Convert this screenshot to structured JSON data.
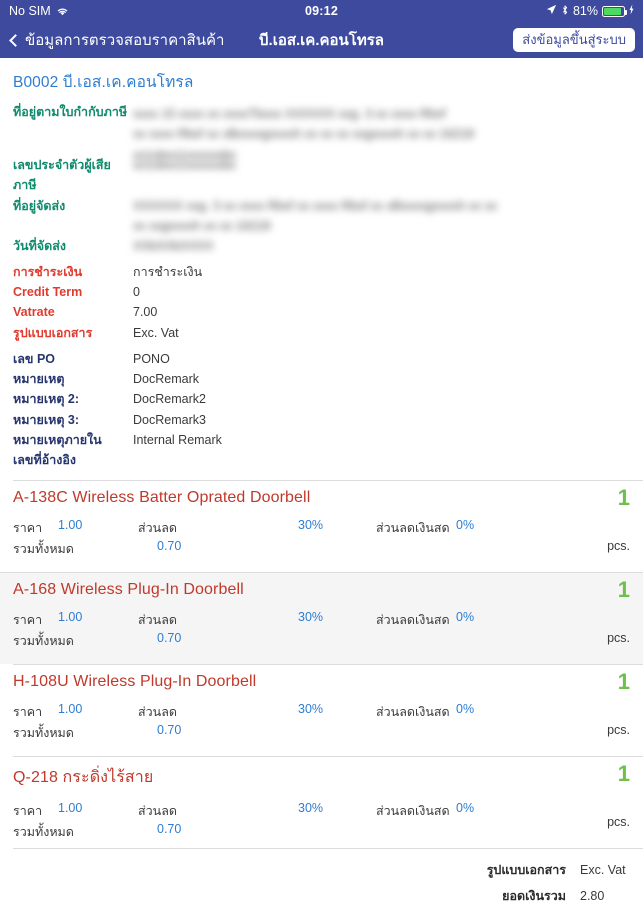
{
  "statusbar": {
    "carrier": "No SIM",
    "wifi_icon": "wifi-icon",
    "time": "09:12",
    "location_icon": "location-arrow-icon",
    "bluetooth_icon": "bluetooth-icon",
    "battery_percent": "81%",
    "battery_icon": "battery-icon",
    "charging_icon": "charging-bolt-icon"
  },
  "navbar": {
    "back_icon": "chevron-left-icon",
    "back_label": "ข้อมูลการตรวจสอบราคาสินค้า",
    "title": "บี.เอส.เค.คอนโทรล",
    "submit_label": "ส่งข้อมูลขึ้นสู่ระบบ"
  },
  "customer": {
    "heading": "B0002 บี.เอส.เค.คอนโทรล"
  },
  "info_rows": [
    {
      "label": "ที่อยู่ตามใบกำกับภาษี",
      "value": "",
      "label_color": "teal",
      "redacted": true
    },
    {
      "label": "เลขประจำตัวผู้เสียภาษี",
      "value": "",
      "label_color": "teal",
      "redacted": true
    },
    {
      "label": "ที่อยู่จัดส่ง",
      "value": "",
      "label_color": "teal",
      "redacted": true
    },
    {
      "label": "วันที่จัดส่ง",
      "value": "",
      "label_color": "teal",
      "redacted": true
    },
    {
      "label": "การชำระเงิน",
      "value": "การชำระเงิน",
      "label_color": "red",
      "redacted": false
    },
    {
      "label": "Credit Term",
      "value": "0",
      "label_color": "red",
      "redacted": false
    },
    {
      "label": "Vatrate",
      "value": "7.00",
      "label_color": "red",
      "redacted": false
    },
    {
      "label": "รูปแบบเอกสาร",
      "value": "Exc. Vat",
      "label_color": "red",
      "redacted": false
    },
    {
      "label": "เลข PO",
      "value": "PONO",
      "label_color": "navy",
      "redacted": false
    },
    {
      "label": "หมายเหตุ",
      "value": "DocRemark",
      "label_color": "navy",
      "redacted": false
    },
    {
      "label": "หมายเหตุ 2:",
      "value": "DocRemark2",
      "label_color": "navy",
      "redacted": false
    },
    {
      "label": "หมายเหตุ 3:",
      "value": "DocRemark3",
      "label_color": "navy",
      "redacted": false
    },
    {
      "label": "หมายเหตุภายใน",
      "value": "Internal Remark",
      "label_color": "navy",
      "redacted": false
    },
    {
      "label": "เลขที่อ้างอิง",
      "value": "",
      "label_color": "navy",
      "redacted": false
    }
  ],
  "item_field_labels": {
    "price": "ราคา",
    "discount": "ส่วนลด",
    "cash_discount": "ส่วนลดเงินสด",
    "total": "รวมทั้งหมด",
    "unit": "pcs."
  },
  "items": [
    {
      "name": "A-138C Wireless  Batter Oprated Doorbell",
      "price": "1.00",
      "discount": "30%",
      "cash_discount": "0%",
      "total": "0.70",
      "qty": "1",
      "unit": "pcs."
    },
    {
      "name": "A-168 Wireless Plug-In Doorbell",
      "price": "1.00",
      "discount": "30%",
      "cash_discount": "0%",
      "total": "0.70",
      "qty": "1",
      "unit": "pcs."
    },
    {
      "name": "H-108U Wireless Plug-In Doorbell",
      "price": "1.00",
      "discount": "30%",
      "cash_discount": "0%",
      "total": "0.70",
      "qty": "1",
      "unit": "pcs."
    },
    {
      "name": "Q-218 กระดิ่งไร้สาย",
      "price": "1.00",
      "discount": "30%",
      "cash_discount": "0%",
      "total": "0.70",
      "qty": "1",
      "unit": "pcs."
    }
  ],
  "footer": {
    "doc_type_label": "รูปแบบเอกสาร",
    "doc_type_value": "Exc. Vat",
    "grand_total_label": "ยอดเงินรวม",
    "grand_total_value": "2.80"
  },
  "colors": {
    "nav_bg": "#3d4a9e",
    "heading_blue": "#2e7dd1",
    "label_teal": "#108a6e",
    "label_red": "#e03b2f",
    "label_navy": "#27356e",
    "item_name_red": "#c0392b",
    "value_blue": "#2e7dd1",
    "qty_green": "#6fbf4b",
    "alt_row_bg": "#f5f5f5"
  }
}
